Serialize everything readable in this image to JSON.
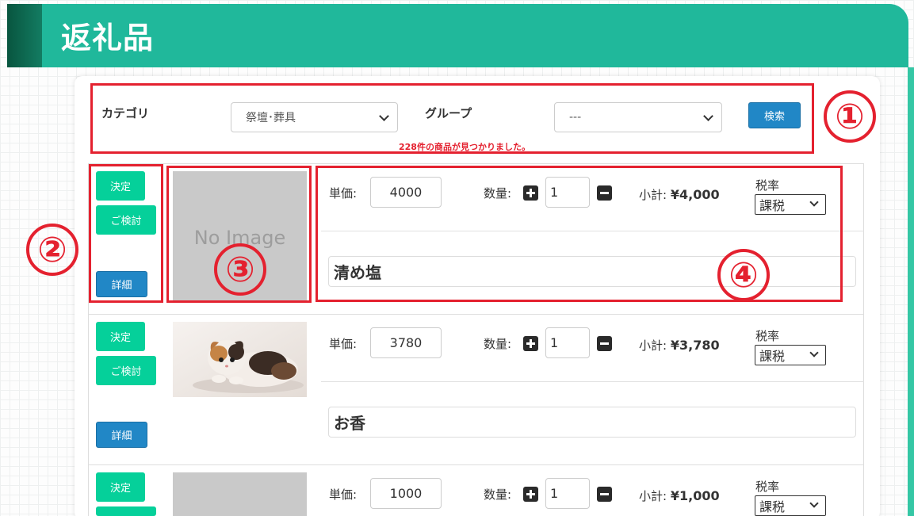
{
  "header": {
    "title": "返礼品"
  },
  "search": {
    "category_label": "カテゴリ",
    "category_value": "祭壇･葬具",
    "group_label": "グループ",
    "group_value": "---",
    "search_button": "検索",
    "result_message": "228件の商品が見つかりました。"
  },
  "labels": {
    "decide": "決定",
    "consider": "ご検討",
    "detail": "詳細",
    "unit_price": "単価:",
    "quantity": "数量:",
    "subtotal": "小計:",
    "tax_rate": "税率",
    "no_image": "No Image"
  },
  "products": [
    {
      "price": "4000",
      "qty": "1",
      "subtotal": "¥4,000",
      "tax": "課税",
      "name": "清め塩",
      "image": "none"
    },
    {
      "price": "3780",
      "qty": "1",
      "subtotal": "¥3,780",
      "tax": "課税",
      "name": "お香",
      "image": "kitten-photo"
    },
    {
      "price": "1000",
      "qty": "1",
      "subtotal": "¥1,000",
      "tax": "課税",
      "name": "",
      "image": "none"
    }
  ],
  "annotations": [
    "①",
    "②",
    "③",
    "④"
  ],
  "colors": {
    "header": "#20b89b",
    "accent_green": "#05d09a",
    "button_blue": "#2187c6",
    "annotation_red": "#e4212f"
  },
  "icons": [
    "plus-icon",
    "minus-icon",
    "chevron-down-icon"
  ]
}
